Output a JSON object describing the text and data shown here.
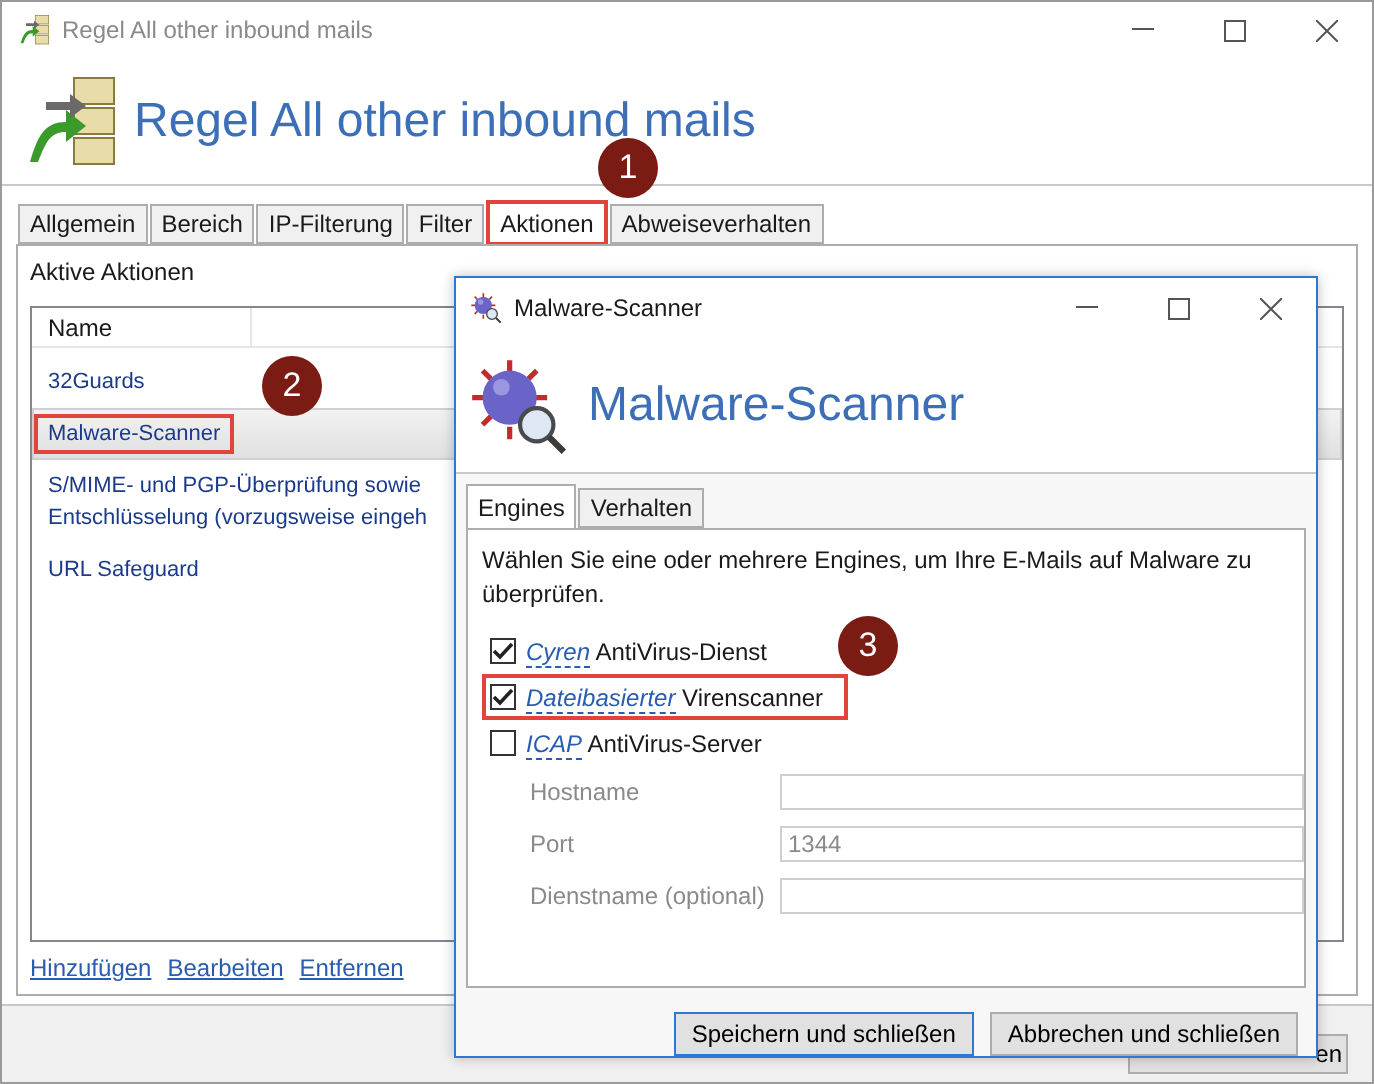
{
  "window": {
    "title": "Regel All other inbound mails",
    "heading": "Regel All other inbound mails"
  },
  "tabs": [
    {
      "label": "Allgemein",
      "selected": false,
      "highlighted": false
    },
    {
      "label": "Bereich",
      "selected": false,
      "highlighted": false
    },
    {
      "label": "IP-Filterung",
      "selected": false,
      "highlighted": false
    },
    {
      "label": "Filter",
      "selected": false,
      "highlighted": false
    },
    {
      "label": "Aktionen",
      "selected": true,
      "highlighted": true
    },
    {
      "label": "Abweiseverhalten",
      "selected": false,
      "highlighted": false
    }
  ],
  "actions": {
    "label": "Aktive Aktionen",
    "column": "Name",
    "rows": [
      {
        "name": "32Guards",
        "selected": false,
        "highlighted": false
      },
      {
        "name": "Malware-Scanner",
        "selected": true,
        "highlighted": true
      },
      {
        "name": "S/MIME- und PGP-Überprüfung sowie\nEntschlüsselung (vorzugsweise eingeh",
        "selected": false,
        "highlighted": false
      },
      {
        "name": "URL Safeguard",
        "selected": false,
        "highlighted": false
      }
    ],
    "links": [
      "Hinzufügen",
      "Bearbeiten",
      "Entfernen"
    ]
  },
  "footer": {
    "button_fragment": "en"
  },
  "dialog": {
    "title": "Malware-Scanner",
    "heading": "Malware-Scanner",
    "tabs": [
      {
        "label": "Engines",
        "selected": true
      },
      {
        "label": "Verhalten",
        "selected": false
      }
    ],
    "description": "Wählen Sie eine oder mehrere Engines, um Ihre E-Mails auf Malware zu überprüfen.",
    "engines": [
      {
        "link": "Cyren",
        "text": "AntiVirus-Dienst",
        "checked": true,
        "highlighted": false
      },
      {
        "link": "Dateibasierter",
        "text": "Virenscanner",
        "checked": true,
        "highlighted": true
      },
      {
        "link": "ICAP",
        "text": "AntiVirus-Server",
        "checked": false,
        "highlighted": false
      }
    ],
    "fields": [
      {
        "label": "Hostname",
        "disabled": true
      },
      {
        "label": "Port",
        "value": "1344",
        "disabled": true
      },
      {
        "label": "Dienstname (optional)",
        "disabled": true
      }
    ],
    "buttons": [
      {
        "label": "Speichern und schließen",
        "default": true
      },
      {
        "label": "Abbrechen und schließen",
        "default": false
      }
    ]
  },
  "callouts": [
    {
      "number": "1"
    },
    {
      "number": "2"
    },
    {
      "number": "3"
    }
  ]
}
